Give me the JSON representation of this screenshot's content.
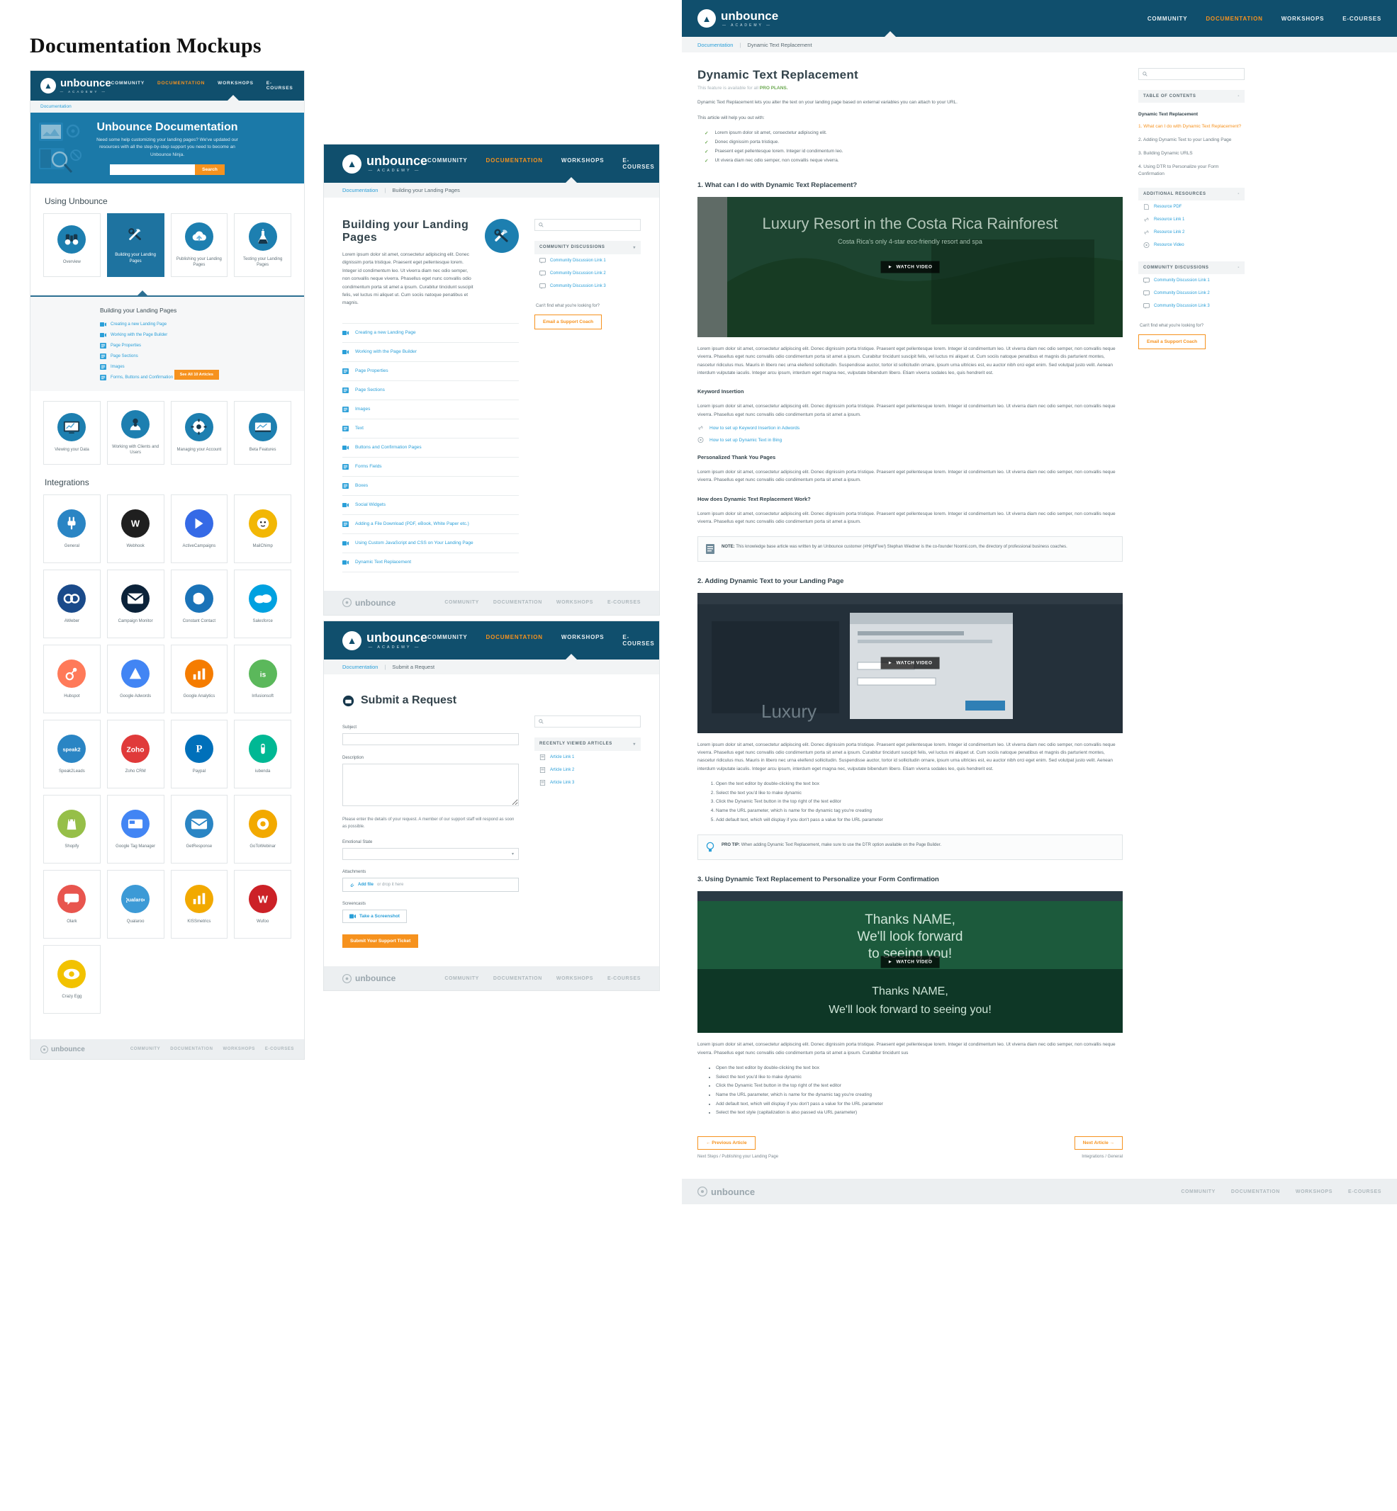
{
  "sheet_title": "Documentation Mockups",
  "brand": {
    "name": "unbounce",
    "sub": "— ACADEMY —",
    "accent": "#f6921e",
    "navy": "#104f6d",
    "blue": "#2a9fd8"
  },
  "nav": {
    "items": [
      {
        "label": "COMMUNITY",
        "active": false
      },
      {
        "label": "DOCUMENTATION",
        "active": true
      },
      {
        "label": "WORKSHOPS",
        "active": false
      },
      {
        "label": "E-COURSES",
        "active": false
      }
    ]
  },
  "footer": {
    "logo": "unbounce",
    "links": [
      "COMMUNITY",
      "DOCUMENTATION",
      "WORKSHOPS",
      "E-COURSES"
    ]
  },
  "home": {
    "breadcrumb": "Documentation",
    "hero": {
      "title": "Unbounce Documentation",
      "subtitle": "Need some help customizing your landing pages? We've updated our resources with all the step-by-step support you need to become an Unbounce Ninja.",
      "search_placeholder": "",
      "search_button": "Search"
    },
    "section_using": "Using Unbounce",
    "using_cards": [
      {
        "label": "Overview",
        "icon": "binoculars-icon",
        "active": false
      },
      {
        "label": "Building your Landing Pages",
        "icon": "tools-icon",
        "active": true
      },
      {
        "label": "Publishing your Landing Pages",
        "icon": "cloud-upload-icon",
        "active": false
      },
      {
        "label": "Testing your Landing Pages",
        "icon": "flask-icon",
        "active": false
      },
      {
        "label": "Viewing your Data",
        "icon": "chart-icon",
        "active": false
      },
      {
        "label": "Working with Clients and Users",
        "icon": "users-icon",
        "active": false
      },
      {
        "label": "Managing your Account",
        "icon": "gear-icon",
        "active": false
      },
      {
        "label": "Beta Features",
        "icon": "beta-icon",
        "active": false
      }
    ],
    "expander": {
      "title": "Building your Landing Pages",
      "links": [
        {
          "label": "Creating a new Landing Page",
          "type": "video"
        },
        {
          "label": "Working with the Page Builder",
          "type": "video"
        },
        {
          "label": "Page Properties",
          "type": "doc"
        },
        {
          "label": "Page Sections",
          "type": "doc"
        },
        {
          "label": "Images",
          "type": "doc"
        },
        {
          "label": "Forms, Buttons and Confirmation",
          "type": "doc"
        }
      ],
      "see_all": "See All 10 Articles"
    },
    "section_integrations": "Integrations",
    "integrations": [
      {
        "label": "General",
        "icon": "plug-icon",
        "color": "#2a85c4"
      },
      {
        "label": "Webhook",
        "icon": "webhook-icon",
        "color": "#1f1f1f"
      },
      {
        "label": "ActiveCampaigns",
        "icon": "activecampaign-icon",
        "color": "#356ae6"
      },
      {
        "label": "MailChimp",
        "icon": "mailchimp-icon",
        "color": "#f2b705"
      },
      {
        "label": "AWeber",
        "icon": "aweber-icon",
        "color": "#1a4a8a"
      },
      {
        "label": "Campaign Monitor",
        "icon": "campaignmonitor-icon",
        "color": "#0b2239"
      },
      {
        "label": "Constant Contact",
        "icon": "constantcontact-icon",
        "color": "#1a73b8"
      },
      {
        "label": "Salesforce",
        "icon": "salesforce-icon",
        "color": "#00a1e0"
      },
      {
        "label": "Hubspot",
        "icon": "hubspot-icon",
        "color": "#ff7a59"
      },
      {
        "label": "Google Adwords",
        "icon": "googleadwords-icon",
        "color": "#4285f4"
      },
      {
        "label": "Google Analytics",
        "icon": "googleanalytics-icon",
        "color": "#f57c00"
      },
      {
        "label": "Infusionsoft",
        "icon": "infusionsoft-icon",
        "color": "#5bb85b"
      },
      {
        "label": "Speak2Leads",
        "icon": "speak2leads-icon",
        "color": "#2a85c4"
      },
      {
        "label": "Zoho CRM",
        "icon": "zoho-icon",
        "color": "#e03a3a"
      },
      {
        "label": "Paypal",
        "icon": "paypal-icon",
        "color": "#0070ba"
      },
      {
        "label": "iubenda",
        "icon": "iubenda-icon",
        "color": "#00b894"
      },
      {
        "label": "Shopify",
        "icon": "shopify-icon",
        "color": "#96bf48"
      },
      {
        "label": "Google Tag Manager",
        "icon": "gtm-icon",
        "color": "#4285f4"
      },
      {
        "label": "GetResponse",
        "icon": "getresponse-icon",
        "color": "#2a85c4"
      },
      {
        "label": "GoToWebinar",
        "icon": "gotowebinar-icon",
        "color": "#f2a900"
      },
      {
        "label": "Olark",
        "icon": "olark-icon",
        "color": "#e8554e"
      },
      {
        "label": "Qualaroo",
        "icon": "qualaroo-icon",
        "color": "#3c9ad6"
      },
      {
        "label": "KISSmetrics",
        "icon": "kissmetrics-icon",
        "color": "#f2a900"
      },
      {
        "label": "Wufoo",
        "icon": "wufoo-icon",
        "color": "#cc2127"
      },
      {
        "label": "Crazy Egg",
        "icon": "crazyegg-icon",
        "color": "#f2c200"
      }
    ]
  },
  "category": {
    "breadcrumb": [
      "Documentation",
      "Building your Landing Pages"
    ],
    "title": "Building your Landing Pages",
    "lede": "Lorem ipsum dolor sit amet, consectetur adipiscing elit. Donec dignissim porta tristique. Praesent eget pellentesque lorem. Integer id condimentum leo. Ut viverra diam nec odio semper, non convallis neque viverra. Phasellus eget nunc convallis odio condimentum porta sit amet a ipsum. Curabitur tincidunt suscipit felis, vel luctus mi aliquet ut. Cum sociis natoque penatibus et magnis.",
    "icon": "tools-icon",
    "articles": [
      {
        "label": "Creating a new Landing Page",
        "type": "video"
      },
      {
        "label": "Working with the Page Builder",
        "type": "video"
      },
      {
        "label": "Page Properties",
        "type": "doc"
      },
      {
        "label": "Page Sections",
        "type": "doc"
      },
      {
        "label": "Images",
        "type": "doc"
      },
      {
        "label": "Text",
        "type": "doc"
      },
      {
        "label": "Buttons and Confirmation Pages",
        "type": "video"
      },
      {
        "label": "Forms Fields",
        "type": "doc"
      },
      {
        "label": "Boxes",
        "type": "doc"
      },
      {
        "label": "Social Widgets",
        "type": "video"
      },
      {
        "label": "Adding a File Download (PDF, eBook, White Paper etc.)",
        "type": "doc"
      },
      {
        "label": "Using Custom JavaScript and CSS on Your Landing Page",
        "type": "video"
      },
      {
        "label": "Dynamic Text Replacement",
        "type": "video"
      }
    ],
    "search_placeholder": "",
    "discussions_header": "COMMUNITY DISCUSSIONS",
    "discussions": [
      "Community Discussion Link 1",
      "Community Discussion Link 2",
      "Community Discussion Link 3"
    ],
    "help_text": "Can't find what you're looking for?",
    "help_button": "Email a Support Coach"
  },
  "request": {
    "breadcrumb": [
      "Documentation",
      "Submit a Request"
    ],
    "title": "Submit a Request",
    "icon": "ticket-icon",
    "fields": {
      "subject_label": "Subject",
      "subject_value": "",
      "description_label": "Description",
      "description_value": "",
      "note": "Please enter the details of your request. A member of our support staff will respond as soon as possible.",
      "emotional_label": "Emotional State",
      "emotional_value": "",
      "attachments_label": "Attachments",
      "attachments_link": "Add file",
      "attachments_hint": "or drop it here",
      "screencasts_label": "Screencasts",
      "screencast_button": "Take a Screenshot",
      "submit_button": "Submit Your Support Ticket"
    },
    "search_placeholder": "",
    "recent_header": "RECENTLY VIEWED ARTICLES",
    "recent": [
      "Article Link 1",
      "Article Link 2",
      "Article Link 3"
    ]
  },
  "article": {
    "breadcrumb": [
      "Documentation",
      "Dynamic Text Replacement"
    ],
    "title": "Dynamic Text Replacement",
    "pro_prefix": "This feature is available for all ",
    "pro_label": "PRO PLANS.",
    "intro": "Dynamic Text Replacement lets you alter the text on your landing page based on external variables you can attach to your URL.",
    "help_intro": "This article will help you out with:",
    "checks": [
      "Lorem ipsum dolor sit amet, consectetur adipiscing elit.",
      "Donec dignissim porta tristique.",
      "Praesent eget pellentesque lorem. Integer id condimentum leo.",
      "Ut vivera diam nec odio semper, non convallis neque viverra."
    ],
    "sections": [
      {
        "heading": "1. What can I do with Dynamic Text Replacement?",
        "video": {
          "label": "WATCH VIDEO",
          "caption": "Luxury Resort in the Costa Rica Rainforest"
        },
        "body": "Lorem ipsum dolor sit amet, consectetur adipiscing elit. Donec dignissim porta tristique. Praesent eget pellentesque lorem. Integer id condimentum leo. Ut viverra diam nec odio semper, non convallis neque viverra. Phasellus eget nunc convallis odio condimentum porta sit amet a ipsum. Curabitur tincidunt suscipit felis, vel luctus mi aliquet ut. Cum sociis natoque penatibus et magnis dis parturient montes, nascetur ridiculus mus. Mauris in libero nec urna eleifend sollicitudin. Suspendisse auctor, tortor id sollicitudin ornare, ipsum urna ultricies est, eu auctor nibh orci eget enim. Sed volutpat justo velit. Aenean interdum vulputate iaculis. Integer arcu ipsum, interdum eget magna nec, vulputate bibendum libero. Etiam viverra sodales leo, quis hendrerit est."
      }
    ],
    "sub_sections": [
      {
        "heading": "Keyword Insertion",
        "body": "Lorem ipsum dolor sit amet, consectetur adipiscing elit. Donec dignissim porta tristique. Praesent eget pellentesque lorem. Integer id condimentum leo. Ut viverra diam nec odio semper, non convallis neque viverra. Phasellus eget nunc convallis odio condimentum porta sit amet a ipsum.",
        "links": [
          {
            "label": "How to set up Keyword Insertion in Adwords",
            "type": "link"
          },
          {
            "label": "How to set up Dynamic Text in Bing",
            "type": "video"
          }
        ]
      },
      {
        "heading": "Personalized Thank You Pages",
        "body": "Lorem ipsum dolor sit amet, consectetur adipiscing elit. Donec dignissim porta tristique. Praesent eget pellentesque lorem. Integer id condimentum leo. Ut viverra diam nec odio semper, non convallis neque viverra. Phasellus eget nunc convallis odio condimentum porta sit amet a ipsum.",
        "links": []
      },
      {
        "heading": "How does Dynamic Text Replacement Work?",
        "body": "Lorem ipsum dolor sit amet, consectetur adipiscing elit. Donec dignissim porta tristique. Praesent eget pellentesque lorem. Integer id condimentum leo. Ut viverra diam nec odio semper, non convallis neque viverra. Phasellus eget nunc convallis odio condimentum porta sit amet a ipsum.",
        "links": []
      }
    ],
    "note_callout": {
      "label": "NOTE:",
      "text": "This knowledge base article was written by an Unbounce customer (#HighFive!) Stephan Wiedner is the co-founder Noomii.com, the directory of professional business coaches."
    },
    "section2": {
      "heading": "2. Adding Dynamic Text to your Landing Page",
      "video_label": "WATCH VIDEO",
      "body": "Lorem ipsum dolor sit amet, consectetur adipiscing elit. Donec dignissim porta tristique. Praesent eget pellentesque lorem. Integer id condimentum leo. Ut viverra diam nec odio semper, non convallis neque viverra. Phasellus eget nunc convallis odio condimentum porta sit amet a ipsum. Curabitur tincidunt suscipit felis, vel luctus mi aliquet ut. Cum sociis natoque penatibus et magnis dis parturient montes, nascetur ridiculus mus. Mauris in libero nec urna eleifend sollicitudin. Suspendisse auctor, tortor id sollicitudin ornare, ipsum urna ultricies est, eu auctor nibh orci eget enim. Sed volutpat justo velit. Aenean interdum vulputate iaculis. Integer arcu ipsum, interdum eget magna nec, vulputate bibendum libero. Etiam viverra sodales leo, quis hendrerit est.",
      "steps": [
        "Open the text editor by double-clicking the text box",
        "Select the text you'd like to make dynamic",
        "Click the Dynamic Text button in the top right of the text editor",
        "Name the URL parameter, which is name for the dynamic tag you're creating",
        "Add default text, which will display if you don't pass a value for the URL parameter"
      ],
      "tip": {
        "label": "PRO TIP:",
        "text": "When adding Dynamic Text Replacement, make sure to use the DTR option available on the Page Builder."
      }
    },
    "section3": {
      "heading": "3. Using Dynamic Text Replacement to Personalize your Form Confirmation",
      "video_label": "WATCH VIDEO",
      "video_caption1": "Thanks NAME,",
      "video_caption2": "We'll look forward",
      "video_caption3": "to seeing you!",
      "video_caption4": "Thanks NAME,",
      "video_caption5": "We'll look forward to seeing you!",
      "body": "Lorem ipsum dolor sit amet, consectetur adipiscing elit. Donec dignissim porta tristique. Praesent eget pellentesque lorem. Integer id condimentum leo. Ut viverra diam nec odio semper, non convallis neque viverra. Phasellus eget nunc convallis odio condimentum porta sit amet a ipsum. Curabitur tincidunt sus",
      "bullets": [
        "Open the text editor by double-clicking the text box",
        "Select the text you'd like to make dynamic",
        "Click the Dynamic Text button in the top right of the text editor",
        "Name the URL parameter, which is name for the dynamic tag you're creating",
        "Add default text, which will display if you don't pass a value for the URL parameter",
        "Select the text style (capitalization is also passed via URL parameter)"
      ]
    },
    "prev_button": "←  Previous Article",
    "next_button": "Next Article  →",
    "prev_caption": "Next Steps / Publishing your Landing Page",
    "next_caption": "Integrations / General",
    "sidebar": {
      "search_placeholder": "",
      "toc_header": "TABLE OF CONTENTS",
      "toc_title": "Dynamic Text Replacement",
      "toc_items": [
        {
          "label": "1. What can I do with Dynamic Text Replacement?",
          "active": true
        },
        {
          "label": "2. Adding Dynamic Text to your Landing Page",
          "active": false
        },
        {
          "label": "3. Building Dynamic URLS",
          "active": false
        },
        {
          "label": "4. Using DTR to Personalize your Form Confirmation",
          "active": false
        }
      ],
      "resources_header": "ADDITIONAL RESOURCES",
      "resources": [
        {
          "label": "Resource PDF",
          "icon": "file-icon"
        },
        {
          "label": "Resource Link 1",
          "icon": "link-icon"
        },
        {
          "label": "Resource Link 2",
          "icon": "link-icon"
        },
        {
          "label": "Resource Video",
          "icon": "play-icon"
        }
      ],
      "discussions_header": "COMMUNITY DISCUSSIONS",
      "discussions": [
        "Community Discussion Link 1",
        "Community Discussion Link 2",
        "Community Discussion Link 3"
      ],
      "help_text": "Can't find what you're looking for?",
      "help_button": "Email a Support Coach"
    }
  }
}
